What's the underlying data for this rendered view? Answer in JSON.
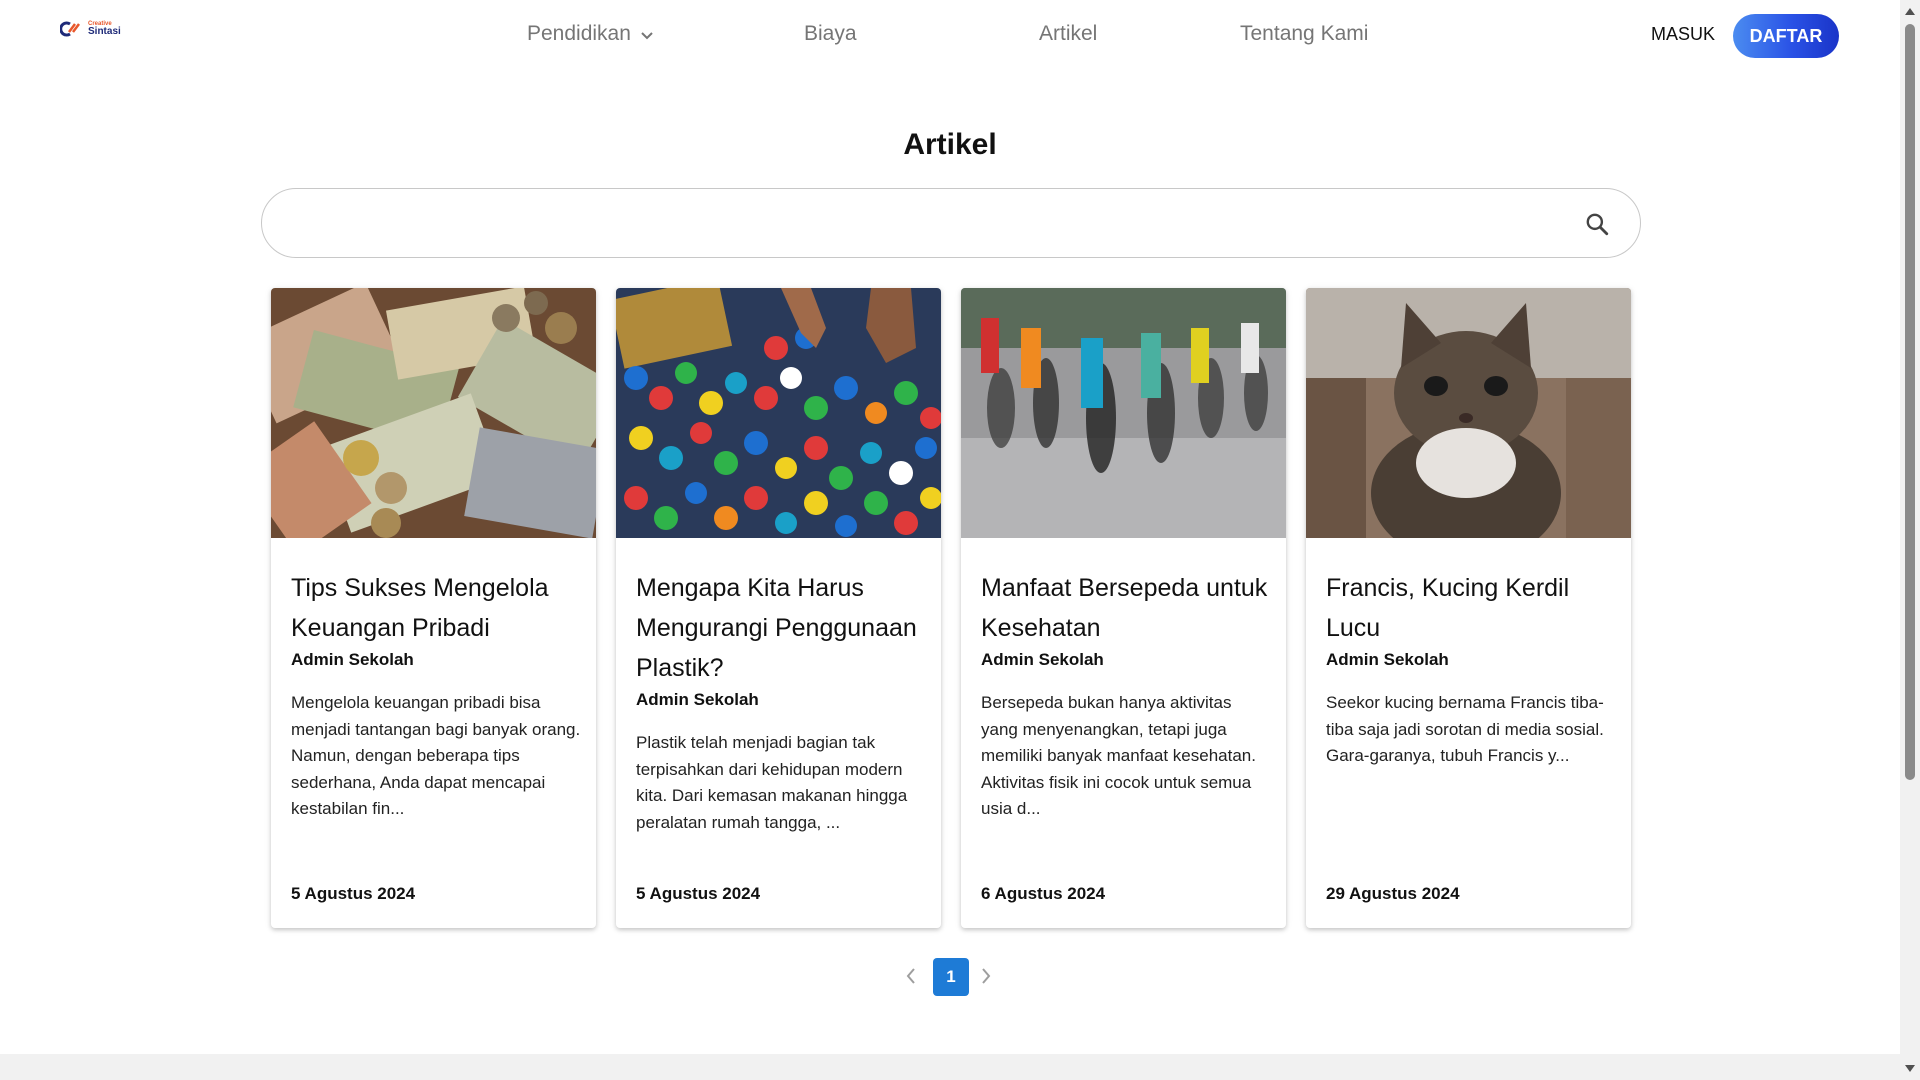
{
  "brand": {
    "small": "Creative",
    "big": "Sintasi"
  },
  "nav": {
    "items": [
      {
        "label": "Pendidikan",
        "has_dropdown": true
      },
      {
        "label": "Biaya"
      },
      {
        "label": "Artikel"
      },
      {
        "label": "Tentang Kami"
      }
    ]
  },
  "auth": {
    "login_label": "MASUK",
    "register_label": "DAFTAR"
  },
  "page": {
    "title": "Artikel"
  },
  "search": {
    "value": "",
    "placeholder": ""
  },
  "articles": [
    {
      "title": "Tips Sukses Mengelola Keuangan Pribadi",
      "author": "Admin Sekolah",
      "excerpt": "Mengelola keuangan pribadi bisa menjadi tantangan bagi banyak orang. Namun, dengan beberapa tips sederhana, Anda dapat mencapai kestabilan fin...",
      "date": "5 Agustus 2024",
      "image": "money-photo"
    },
    {
      "title": "Mengapa Kita Harus Mengurangi Penggunaan Plastik?",
      "author": "Admin Sekolah",
      "excerpt": "Plastik telah menjadi bagian tak terpisahkan dari kehidupan modern kita. Dari kemasan makanan hingga peralatan rumah tangga, ...",
      "date": "5 Agustus 2024",
      "image": "plastic-caps-photo"
    },
    {
      "title": "Manfaat Bersepeda untuk Kesehatan",
      "author": "Admin Sekolah",
      "excerpt": "Bersepeda bukan hanya aktivitas yang menyenangkan, tetapi juga memiliki banyak manfaat kesehatan. Aktivitas fisik ini cocok untuk semua usia d...",
      "date": "6 Agustus 2024",
      "image": "cycling-photo"
    },
    {
      "title": "Francis, Kucing Kerdil Lucu",
      "author": "Admin Sekolah",
      "excerpt": "Seekor kucing bernama Francis tiba-tiba saja jadi sorotan di media sosial. Gara-garanya, tubuh Francis y...",
      "date": "29 Agustus 2024",
      "image": "cat-photo"
    }
  ],
  "pagination": {
    "current": "1",
    "prev_icon": "chevron-left-icon",
    "next_icon": "chevron-right-icon"
  },
  "colors": {
    "accent": "#1e7bd6",
    "register_gradient_start": "#4b8cf0",
    "register_gradient_end": "#1a34c8",
    "nav_text": "#757575"
  }
}
